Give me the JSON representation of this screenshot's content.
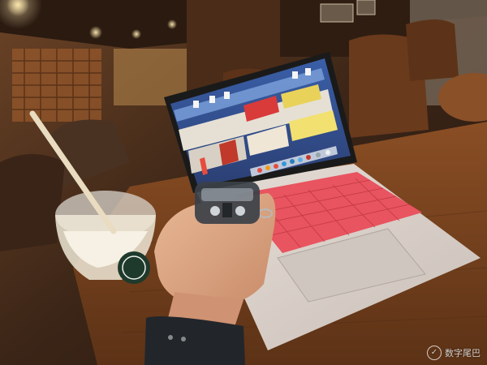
{
  "scene": {
    "description_free": true,
    "watermark": {
      "text": "数字尾巴",
      "icon": "leaf-logo-icon"
    },
    "colors": {
      "keyboard_accent": "#e8545f",
      "laptop_body": "#dcd3cc",
      "table_wood": "#7a4420",
      "cafe_ambient": "#5a3520"
    }
  }
}
